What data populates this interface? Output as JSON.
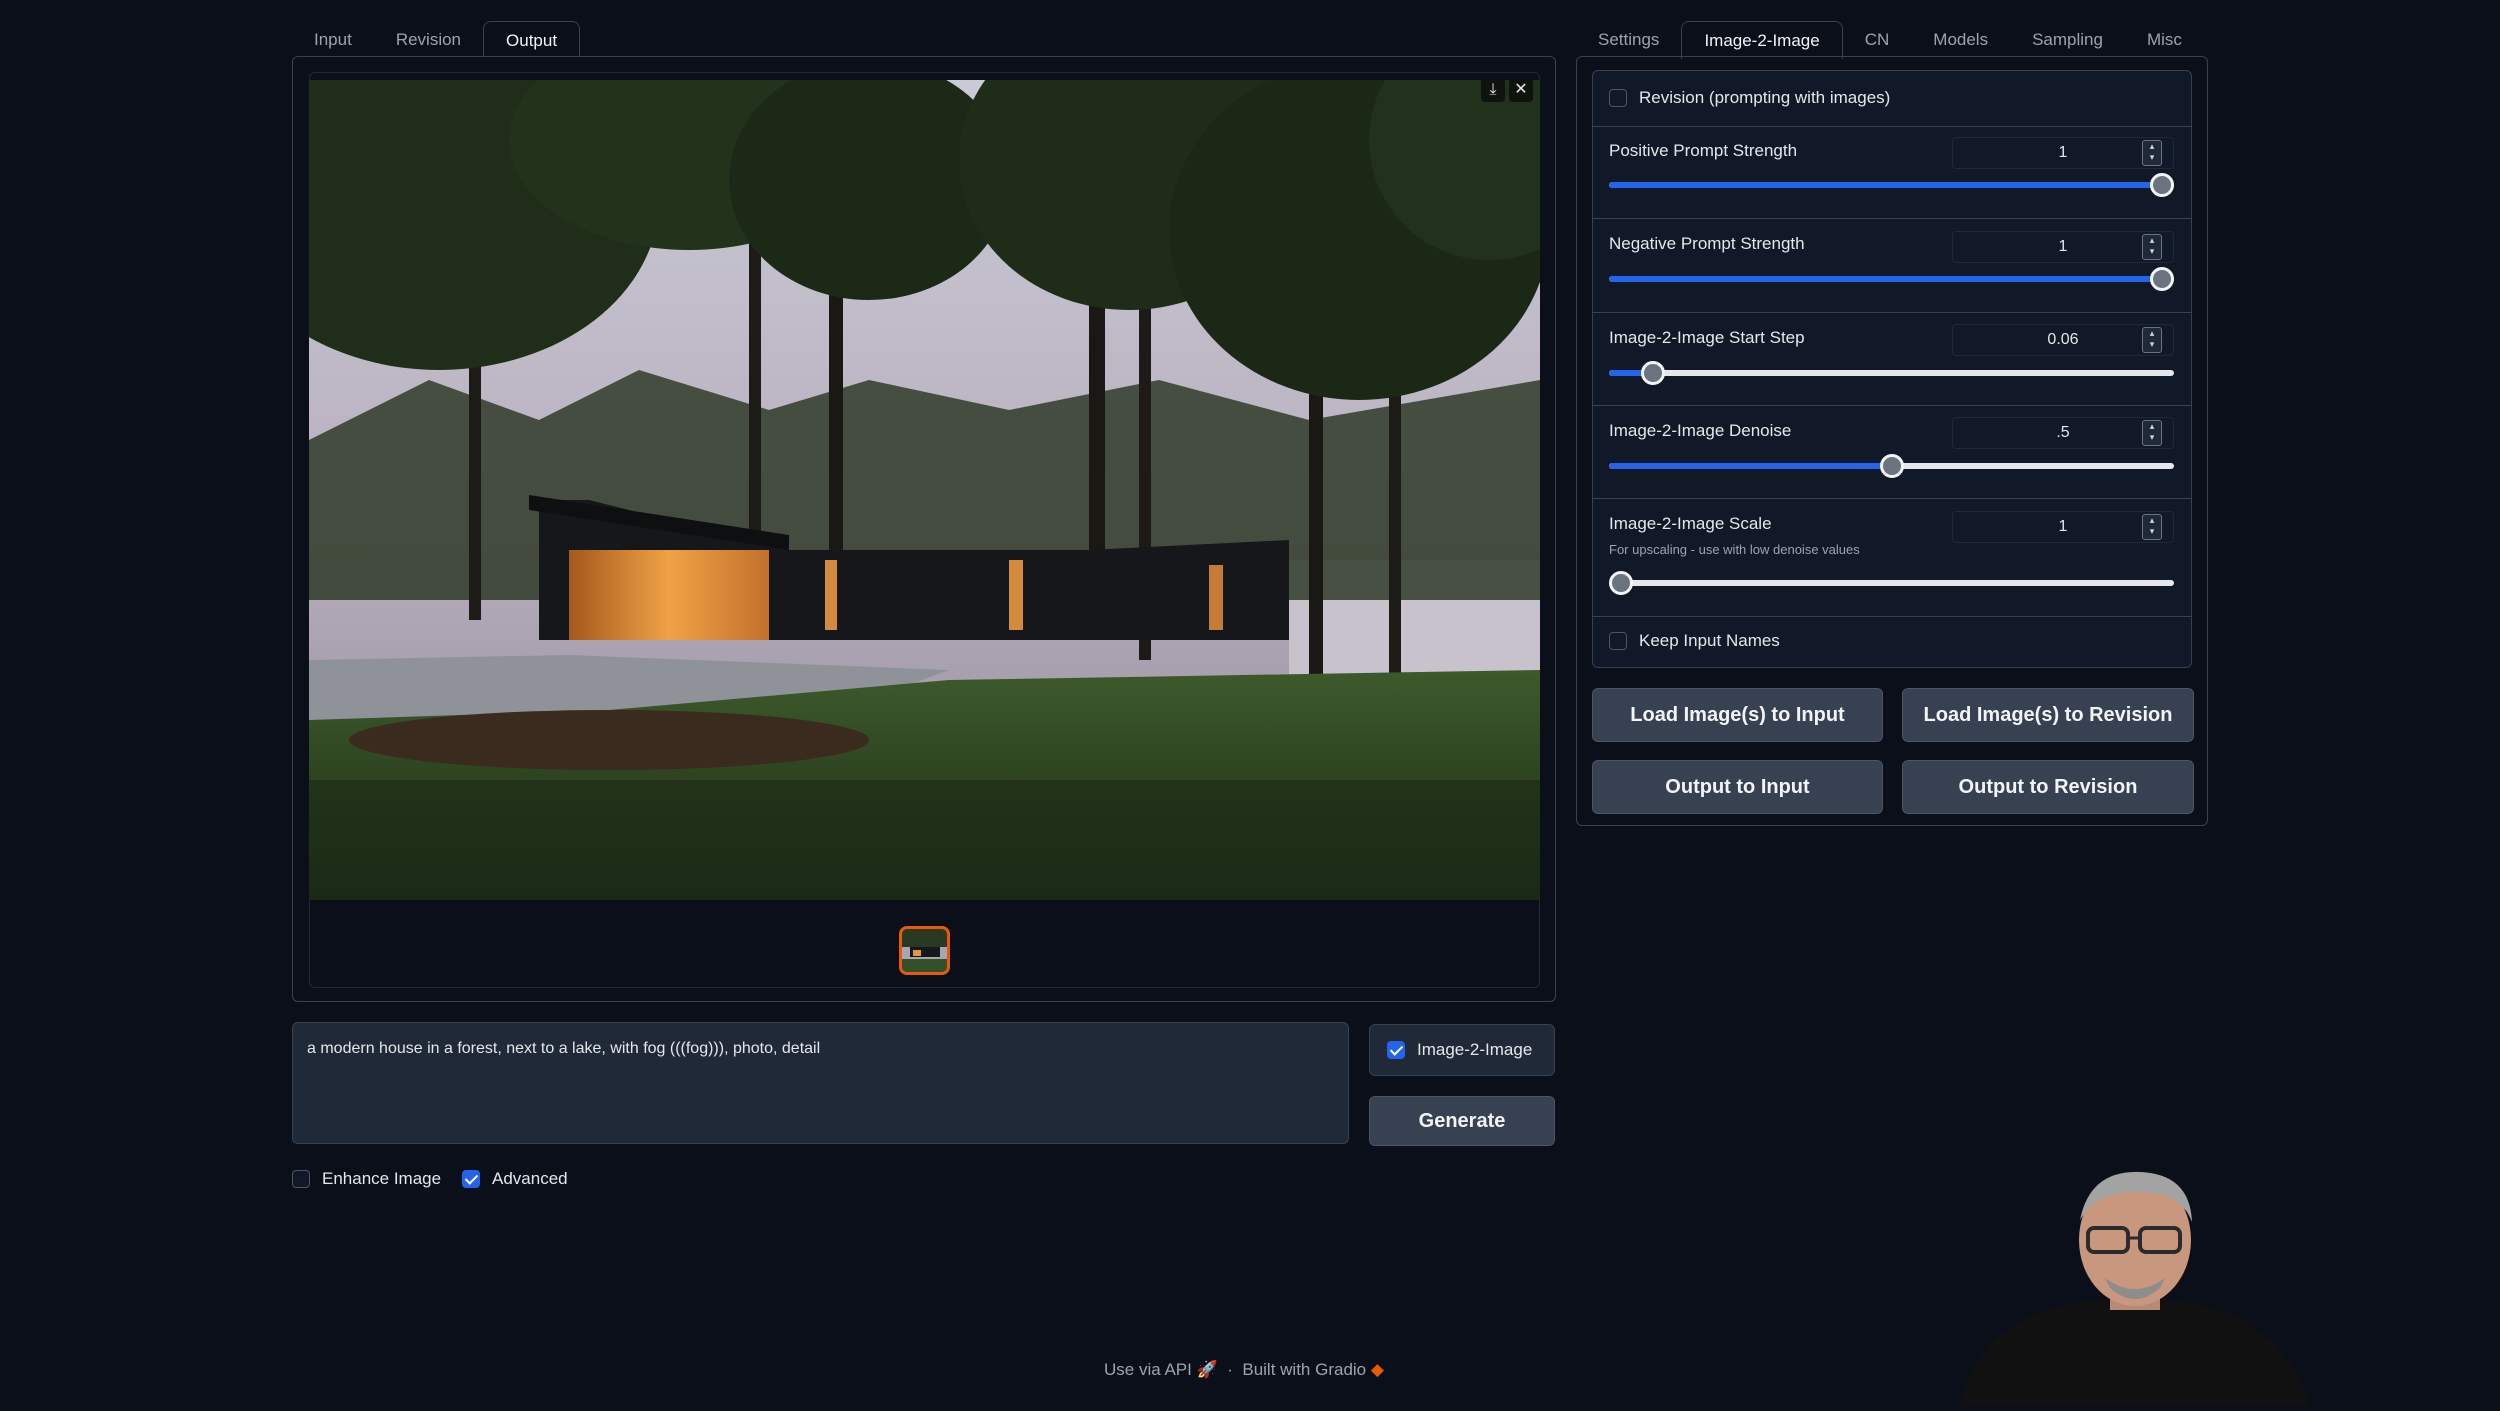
{
  "left_tabs": [
    {
      "label": "Input",
      "active": false
    },
    {
      "label": "Revision",
      "active": false
    },
    {
      "label": "Output",
      "active": true
    }
  ],
  "right_tabs": [
    {
      "label": "Settings",
      "active": false
    },
    {
      "label": "Image-2-Image",
      "active": true
    },
    {
      "label": "CN",
      "active": false
    },
    {
      "label": "Models",
      "active": false
    },
    {
      "label": "Sampling",
      "active": false
    },
    {
      "label": "Misc",
      "active": false
    }
  ],
  "output": {
    "image_icon": "house-in-forest-photo",
    "download_icon": "download-icon",
    "close_icon": "close-icon"
  },
  "prompt": {
    "value": "a modern house in a forest, next to a lake, with fog (((fog))), photo, detail"
  },
  "i2i_toggle": {
    "label": "Image-2-Image",
    "checked": true
  },
  "generate_label": "Generate",
  "options": {
    "enhance": {
      "label": "Enhance Image",
      "checked": false
    },
    "advanced": {
      "label": "Advanced",
      "checked": true
    }
  },
  "i2i_settings": {
    "revision": {
      "label": "Revision (prompting with images)",
      "checked": false
    },
    "positive_strength": {
      "label": "Positive Prompt Strength",
      "value": "1",
      "fraction": 1.0
    },
    "negative_strength": {
      "label": "Negative Prompt Strength",
      "value": "1",
      "fraction": 1.0
    },
    "start_step": {
      "label": "Image-2-Image Start Step",
      "value": "0.06",
      "fraction": 0.06
    },
    "denoise": {
      "label": "Image-2-Image Denoise",
      "value": ".5",
      "fraction": 0.5
    },
    "scale": {
      "label": "Image-2-Image Scale",
      "info": "For upscaling - use with low denoise values",
      "value": "1",
      "fraction": 0.0
    },
    "keep_names": {
      "label": "Keep Input Names",
      "checked": false
    }
  },
  "buttons": {
    "load_input": "Load Image(s) to Input",
    "load_revision": "Load Image(s) to Revision",
    "output_input": "Output to Input",
    "output_revision": "Output to Revision"
  },
  "footer": {
    "api": "Use via API",
    "sep": "·",
    "built": "Built with Gradio"
  },
  "colors": {
    "background": "#0b0f19",
    "accent_blue": "#2563eb",
    "accent_orange": "#ea580c",
    "panel": "#111827"
  }
}
